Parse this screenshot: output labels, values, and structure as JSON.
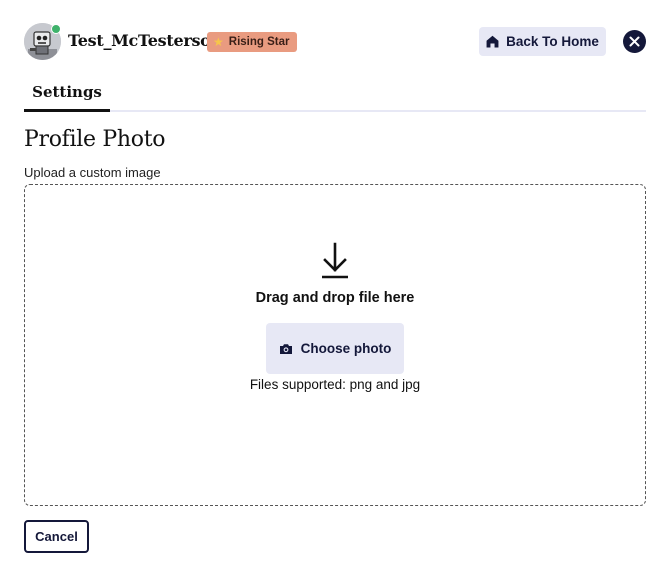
{
  "header": {
    "username": "Test_McTesterson",
    "badge_label": "Rising Star",
    "badge_icon": "star-icon",
    "home_button_label": "Back To Home",
    "online_status_color": "#3fb26b"
  },
  "tabs": [
    {
      "label": "Settings",
      "active": true
    }
  ],
  "profile_photo": {
    "title": "Profile Photo",
    "subtitle": "Upload a custom image",
    "drop_title": "Drag and drop file here",
    "choose_button_label": "Choose photo",
    "supported_note": "Files supported: png and jpg"
  },
  "footer": {
    "cancel_label": "Cancel"
  },
  "colors": {
    "accent_dark": "#14183a",
    "button_bg": "#e7e8f5",
    "badge_bg": "#e99b80"
  }
}
